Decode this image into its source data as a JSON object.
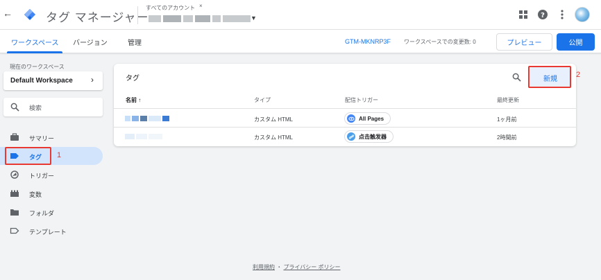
{
  "header": {
    "app_title": "タグ マネージャー",
    "account_label": "すべてのアカウント",
    "account_close": "×"
  },
  "tabs": {
    "items": [
      {
        "label": "ワークスペース"
      },
      {
        "label": "バージョン"
      },
      {
        "label": "管理"
      }
    ],
    "container_id": "GTM-MKNRP3F",
    "changes_text": "ワークスペースでの変更数: 0",
    "preview_label": "プレビュー",
    "publish_label": "公開"
  },
  "sidebar": {
    "workspace_heading": "現在のワークスペース",
    "workspace_name": "Default Workspace",
    "search_placeholder": "検索",
    "items": [
      {
        "label": "サマリー",
        "icon": "briefcase-icon"
      },
      {
        "label": "タグ",
        "icon": "tag-icon"
      },
      {
        "label": "トリガー",
        "icon": "trigger-icon"
      },
      {
        "label": "変数",
        "icon": "variables-icon"
      },
      {
        "label": "フォルダ",
        "icon": "folder-icon"
      },
      {
        "label": "テンプレート",
        "icon": "template-icon"
      }
    ]
  },
  "annotations": {
    "one": "1",
    "two": "2",
    "highlight_color": "#e8382f"
  },
  "tags_card": {
    "title": "タグ",
    "new_button": "新規",
    "columns": [
      "名前 ↑",
      "タイプ",
      "配信トリガー",
      "最終更新"
    ],
    "rows": [
      {
        "type": "カスタム HTML",
        "trigger": "All Pages",
        "trigger_icon": "eye-icon",
        "updated": "1ヶ月前"
      },
      {
        "type": "カスタム HTML",
        "trigger": "点击触发器",
        "trigger_icon": "link-icon",
        "updated": "2時間前"
      }
    ]
  },
  "footer": {
    "terms": "利用規約",
    "sep": "・",
    "privacy": "プライバシー ポリシー"
  },
  "colors": {
    "accent": "#1a73e8",
    "active_bg": "#d2e3fc"
  }
}
